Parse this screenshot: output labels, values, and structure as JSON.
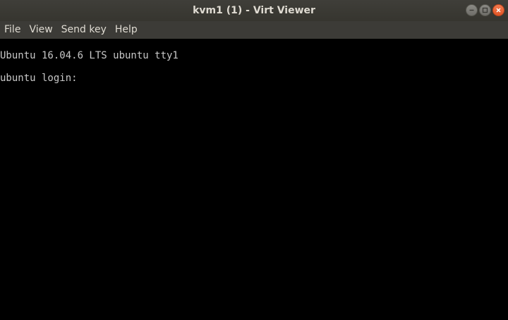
{
  "window": {
    "title": "kvm1 (1) - Virt Viewer",
    "controls": [
      {
        "icon": "minimize-icon"
      },
      {
        "icon": "maximize-icon"
      },
      {
        "icon": "close-icon"
      }
    ]
  },
  "menu": {
    "items": [
      "File",
      "View",
      "Send key",
      "Help"
    ]
  },
  "console": {
    "banner": "Ubuntu 16.04.6 LTS ubuntu tty1",
    "login_prompt": "ubuntu login: "
  },
  "colors": {
    "titlebar": "#3c3b37",
    "close_button": "#e95420",
    "console_background": "#000000",
    "console_text": "#c8c8c8"
  }
}
